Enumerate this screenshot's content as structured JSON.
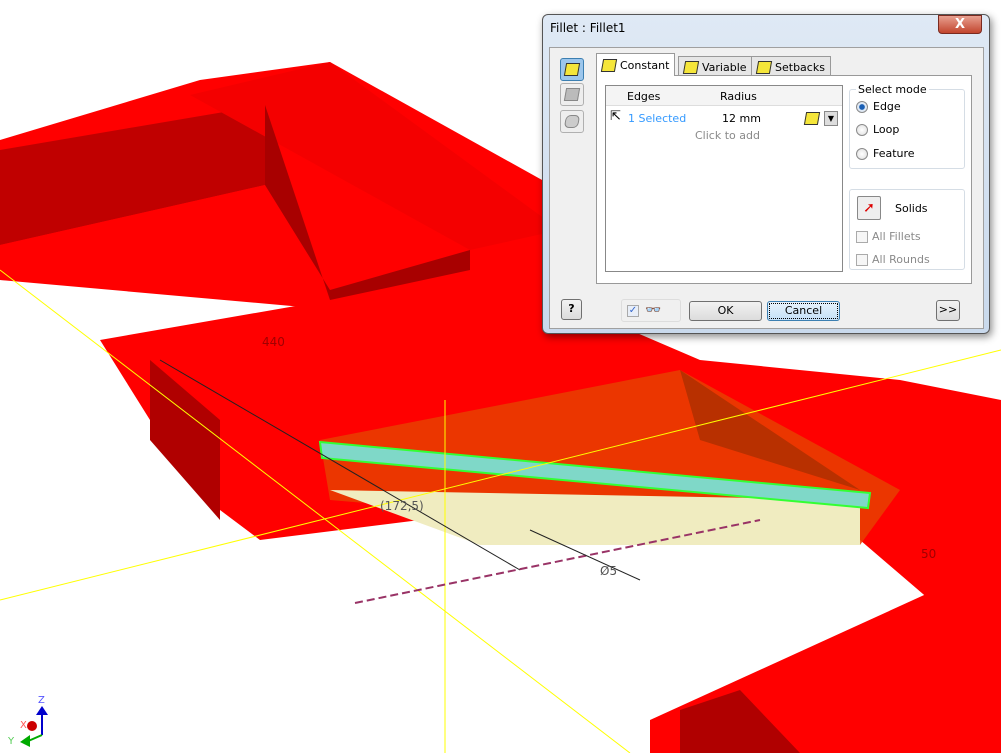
{
  "viewport": {
    "dimensions": [
      "440",
      "(172,5)",
      "Ø5",
      "50"
    ],
    "axes": {
      "x": "X",
      "y": "Y",
      "z": "Z"
    },
    "colors": {
      "part": "#ff0000",
      "shade": "#b30000",
      "highlight": "#33ff33",
      "preview": "#f0ecc0"
    }
  },
  "dialog": {
    "title": "Fillet : Fillet1",
    "close_label": "X",
    "side_icons": [
      "constant-fillet-icon",
      "face-fillet-icon",
      "full-round-fillet-icon"
    ],
    "tabs": [
      {
        "label": "Constant",
        "active": true
      },
      {
        "label": "Variable"
      },
      {
        "label": "Setbacks"
      }
    ],
    "table": {
      "headers": [
        "Edges",
        "Radius"
      ],
      "rows": [
        {
          "edges": "1 Selected",
          "radius": "12 mm"
        }
      ],
      "add_label": "Click to add"
    },
    "select_mode": {
      "title": "Select mode",
      "options": [
        {
          "label": "Edge",
          "selected": true
        },
        {
          "label": "Loop",
          "selected": false
        },
        {
          "label": "Feature",
          "selected": false
        }
      ]
    },
    "solids_label": "Solids",
    "all_fillets": "All Fillets",
    "all_rounds": "All Rounds",
    "preview_checked": true,
    "ok": "OK",
    "cancel": "Cancel",
    "more": ">>",
    "help": "?"
  }
}
